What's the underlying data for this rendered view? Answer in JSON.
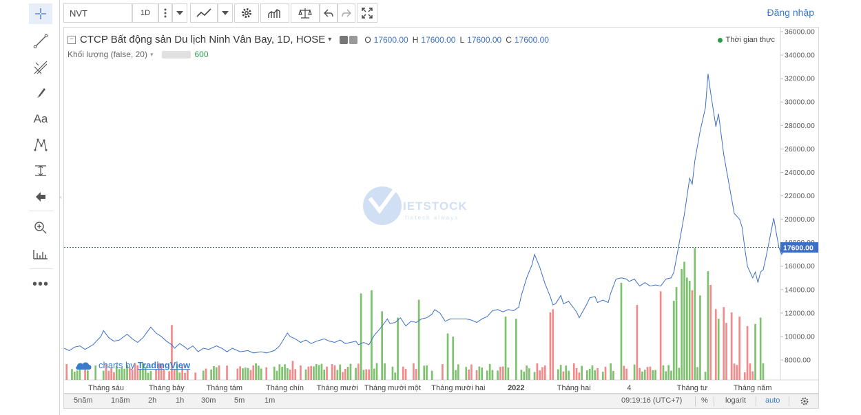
{
  "toolbar": {
    "symbol": "NVT",
    "interval": "1D",
    "login_label": "Đăng nhập"
  },
  "legend": {
    "title": "CTCP Bất động sản Du lịch Ninh Vân Bay, 1D, HOSE",
    "o_label": "O",
    "o_value": "17600.00",
    "h_label": "H",
    "h_value": "17600.00",
    "l_label": "L",
    "l_value": "17600.00",
    "c_label": "C",
    "c_value": "17600.00",
    "volume_label": "Khối lượng (false, 20)",
    "volume_value": "600",
    "realtime_label": "Thời gian thực",
    "collapse_symbol": "−",
    "dropdown_symbol": "▾"
  },
  "watermark": {
    "brand": "IETSTOCK",
    "tagline": "fintech always",
    "brand_color": "#5b8ed6"
  },
  "branding": {
    "charts_by": "charts by",
    "tradingview": "TradingView"
  },
  "bottom": {
    "ranges": [
      "5năm",
      "1năm",
      "2h",
      "1h",
      "30m",
      "5m",
      "1m"
    ],
    "time": "09:19:16 (UTC+7)",
    "percent": "%",
    "log": "logarit",
    "auto": "auto"
  },
  "colors": {
    "line": "#3b6fc7",
    "up": "#7ec16e",
    "down": "#f18b8b",
    "price_tag": "#3b6fc7",
    "realtime_dot": "#2e9a4a",
    "accent": "#3b7bc7"
  },
  "chart_data": {
    "type": "line",
    "title": "CTCP Bất động sản Du lịch Ninh Vân Bay, 1D, HOSE",
    "last_price": 17600,
    "last_price_label": "17600.00",
    "y_ticks": [
      "36000.00",
      "34000.00",
      "32000.00",
      "30000.00",
      "28000.00",
      "26000.00",
      "24000.00",
      "22000.00",
      "20000.00",
      "18000.00",
      "16000.00",
      "14000.00",
      "12000.00",
      "10000.00",
      "8000.00"
    ],
    "ylim": [
      6300,
      36000
    ],
    "x_ticks": [
      "Tháng sáu",
      "Tháng bảy",
      "Tháng tám",
      "Tháng chín",
      "Tháng mười",
      "Tháng mười một",
      "Tháng mười hai",
      "2022",
      "Tháng hai",
      "4",
      "Tháng tư",
      "Tháng năm"
    ],
    "x_tick_index": [
      16,
      39,
      61,
      84,
      104,
      125,
      150,
      172,
      194,
      215,
      239,
      262
    ],
    "n_points": 267,
    "price_keypoints": [
      [
        0,
        9000
      ],
      [
        2,
        8800
      ],
      [
        4,
        9100
      ],
      [
        6,
        9200
      ],
      [
        8,
        8900
      ],
      [
        11,
        9300
      ],
      [
        14,
        10000
      ],
      [
        15,
        10500
      ],
      [
        17,
        9900
      ],
      [
        19,
        9600
      ],
      [
        21,
        9700
      ],
      [
        24,
        10200
      ],
      [
        26,
        9800
      ],
      [
        28,
        9500
      ],
      [
        30,
        9900
      ],
      [
        33,
        10800
      ],
      [
        35,
        10300
      ],
      [
        37,
        10000
      ],
      [
        39,
        9600
      ],
      [
        41,
        9300
      ],
      [
        42,
        9000
      ],
      [
        44,
        9400
      ],
      [
        46,
        9100
      ],
      [
        47,
        8900
      ],
      [
        49,
        9200
      ],
      [
        51,
        8700
      ],
      [
        53,
        9000
      ],
      [
        55,
        8900
      ],
      [
        58,
        9200
      ],
      [
        60,
        9000
      ],
      [
        62,
        8700
      ],
      [
        64,
        9000
      ],
      [
        67,
        8700
      ],
      [
        70,
        8800
      ],
      [
        72,
        8600
      ],
      [
        75,
        8700
      ],
      [
        77,
        8600
      ],
      [
        80,
        8800
      ],
      [
        82,
        9200
      ],
      [
        85,
        10300
      ],
      [
        86,
        10000
      ],
      [
        88,
        9800
      ],
      [
        90,
        9500
      ],
      [
        92,
        9700
      ],
      [
        94,
        9400
      ],
      [
        96,
        9600
      ],
      [
        99,
        9800
      ],
      [
        101,
        9600
      ],
      [
        103,
        9500
      ],
      [
        105,
        9700
      ],
      [
        107,
        9400
      ],
      [
        109,
        9500
      ],
      [
        111,
        9600
      ],
      [
        112,
        9300
      ],
      [
        114,
        9500
      ],
      [
        116,
        9300
      ],
      [
        118,
        10100
      ],
      [
        120,
        10600
      ],
      [
        122,
        11200
      ],
      [
        123,
        11500
      ],
      [
        124,
        11100
      ],
      [
        126,
        11200
      ],
      [
        128,
        11600
      ],
      [
        130,
        10900
      ],
      [
        132,
        11300
      ],
      [
        134,
        11200
      ],
      [
        136,
        11500
      ],
      [
        138,
        11600
      ],
      [
        140,
        11900
      ],
      [
        141,
        12300
      ],
      [
        143,
        12000
      ],
      [
        145,
        11300
      ],
      [
        147,
        11500
      ],
      [
        150,
        11500
      ],
      [
        153,
        11500
      ],
      [
        155,
        11400
      ],
      [
        157,
        11200
      ],
      [
        159,
        11500
      ],
      [
        161,
        11700
      ],
      [
        163,
        12200
      ],
      [
        165,
        12300
      ],
      [
        167,
        12100
      ],
      [
        169,
        12300
      ],
      [
        171,
        12200
      ],
      [
        173,
        12500
      ],
      [
        174,
        13500
      ],
      [
        176,
        15000
      ],
      [
        178,
        16100
      ],
      [
        179,
        17000
      ],
      [
        181,
        15900
      ],
      [
        183,
        14500
      ],
      [
        185,
        13400
      ],
      [
        186,
        12700
      ],
      [
        187,
        12800
      ],
      [
        189,
        13500
      ],
      [
        190,
        12800
      ],
      [
        192,
        13000
      ],
      [
        193,
        12700
      ],
      [
        195,
        12100
      ],
      [
        196,
        11600
      ],
      [
        198,
        12400
      ],
      [
        199,
        12800
      ],
      [
        200,
        13300
      ],
      [
        202,
        13400
      ],
      [
        203,
        12900
      ],
      [
        205,
        13100
      ],
      [
        207,
        12900
      ],
      [
        208,
        13700
      ],
      [
        210,
        14900
      ],
      [
        212,
        15000
      ],
      [
        214,
        14900
      ],
      [
        215,
        14700
      ],
      [
        217,
        14900
      ],
      [
        219,
        14300
      ],
      [
        221,
        14600
      ],
      [
        223,
        14300
      ],
      [
        225,
        14400
      ],
      [
        227,
        14300
      ],
      [
        229,
        14900
      ],
      [
        231,
        15000
      ],
      [
        232,
        15500
      ],
      [
        234,
        17900
      ],
      [
        236,
        20400
      ],
      [
        238,
        23500
      ],
      [
        239,
        23000
      ],
      [
        240,
        25000
      ],
      [
        242,
        27500
      ],
      [
        244,
        29500
      ],
      [
        245,
        32400
      ],
      [
        246,
        30800
      ],
      [
        248,
        27900
      ],
      [
        249,
        29000
      ],
      [
        251,
        25500
      ],
      [
        253,
        23000
      ],
      [
        255,
        20500
      ],
      [
        257,
        20000
      ],
      [
        258,
        19300
      ],
      [
        259,
        17500
      ],
      [
        260,
        16000
      ],
      [
        262,
        15000
      ],
      [
        263,
        15500
      ],
      [
        264,
        14600
      ],
      [
        265,
        15500
      ],
      [
        266,
        15700
      ],
      [
        267,
        16700
      ],
      [
        268,
        17800
      ],
      [
        270,
        20100
      ],
      [
        271,
        18800
      ],
      [
        272,
        17600
      ],
      [
        273,
        17000
      ],
      [
        275,
        17600
      ]
    ],
    "volume_series": {
      "name": "Khối lượng (false, 20)",
      "spikes": [
        [
          41,
          5200
        ],
        [
          87,
          1800
        ],
        [
          113,
          8200
        ],
        [
          117,
          8500
        ],
        [
          121,
          6500
        ],
        [
          127,
          5900
        ],
        [
          135,
          7600
        ],
        [
          146,
          4400
        ],
        [
          148,
          4100
        ],
        [
          168,
          6000
        ],
        [
          172,
          5800
        ],
        [
          185,
          6400
        ],
        [
          186,
          6700
        ],
        [
          212,
          9200
        ],
        [
          218,
          7100
        ],
        [
          227,
          8400
        ],
        [
          232,
          7500
        ],
        [
          233,
          8800
        ],
        [
          235,
          10500
        ],
        [
          236,
          11200
        ],
        [
          237,
          9700
        ],
        [
          238,
          9400
        ],
        [
          239,
          8500
        ],
        [
          240,
          12500
        ],
        [
          242,
          8000
        ],
        [
          245,
          10300
        ],
        [
          246,
          9000
        ],
        [
          248,
          6700
        ],
        [
          249,
          5800
        ],
        [
          251,
          6900
        ],
        [
          252,
          5400
        ],
        [
          254,
          6400
        ],
        [
          257,
          6000
        ],
        [
          260,
          5100
        ],
        [
          263,
          5300
        ],
        [
          265,
          5900
        ],
        [
          267,
          6200
        ],
        [
          269,
          8400
        ],
        [
          273,
          5600
        ]
      ]
    }
  }
}
